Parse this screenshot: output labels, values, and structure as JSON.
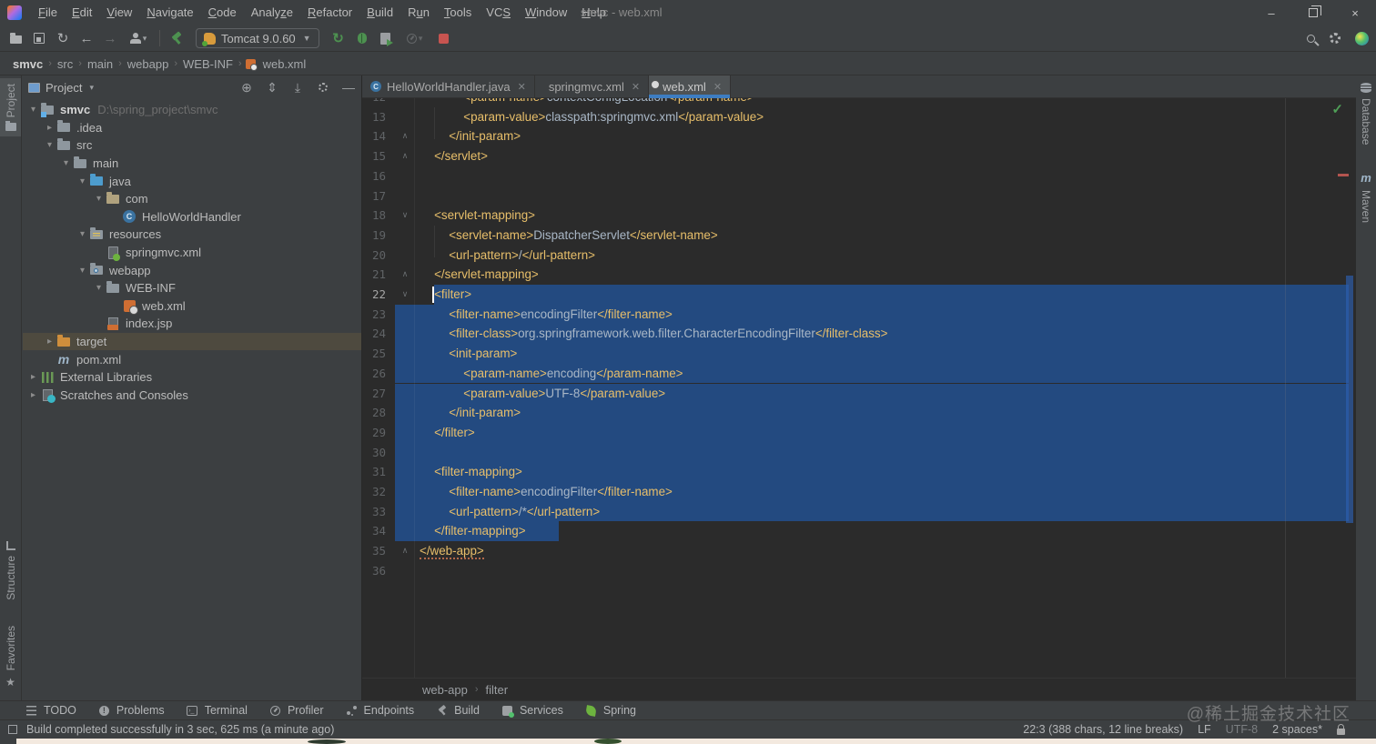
{
  "window": {
    "title": "smvc - web.xml",
    "menus": [
      {
        "label": "File",
        "u": 0
      },
      {
        "label": "Edit",
        "u": 0
      },
      {
        "label": "View",
        "u": 0
      },
      {
        "label": "Navigate",
        "u": 0
      },
      {
        "label": "Code",
        "u": 0
      },
      {
        "label": "Analyze",
        "u": 5
      },
      {
        "label": "Refactor",
        "u": 0
      },
      {
        "label": "Build",
        "u": 0
      },
      {
        "label": "Run",
        "u": 1
      },
      {
        "label": "Tools",
        "u": 0
      },
      {
        "label": "VCS",
        "u": 2
      },
      {
        "label": "Window",
        "u": 0
      },
      {
        "label": "Help",
        "u": 0
      }
    ]
  },
  "toolbar": {
    "run_config": "Tomcat 9.0.60"
  },
  "breadcrumbs": [
    "smvc",
    "src",
    "main",
    "webapp",
    "WEB-INF",
    "web.xml"
  ],
  "left_stripe": {
    "project": "Project",
    "structure": "Structure",
    "favorites": "Favorites"
  },
  "right_stripe": {
    "database": "Database",
    "maven": "Maven"
  },
  "project_panel": {
    "title": "Project",
    "tree": [
      {
        "depth": 0,
        "chevron": "open",
        "icon": "module",
        "label": "smvc",
        "hint": "D:\\spring_project\\smvc",
        "bold": true
      },
      {
        "depth": 1,
        "chevron": "closed",
        "icon": "folder",
        "label": ".idea"
      },
      {
        "depth": 1,
        "chevron": "open",
        "icon": "folder",
        "label": "src"
      },
      {
        "depth": 2,
        "chevron": "open",
        "icon": "folder",
        "label": "main"
      },
      {
        "depth": 3,
        "chevron": "open",
        "icon": "folder-src",
        "label": "java"
      },
      {
        "depth": 4,
        "chevron": "open",
        "icon": "package",
        "label": "com"
      },
      {
        "depth": 5,
        "chevron": "none",
        "icon": "class",
        "label": "HelloWorldHandler"
      },
      {
        "depth": 3,
        "chevron": "open",
        "icon": "folder-res",
        "label": "resources"
      },
      {
        "depth": 4,
        "chevron": "none",
        "icon": "file-spring",
        "label": "springmvc.xml"
      },
      {
        "depth": 3,
        "chevron": "open",
        "icon": "folder-web",
        "label": "webapp"
      },
      {
        "depth": 4,
        "chevron": "open",
        "icon": "folder",
        "label": "WEB-INF"
      },
      {
        "depth": 5,
        "chevron": "none",
        "icon": "file-web",
        "label": "web.xml"
      },
      {
        "depth": 4,
        "chevron": "none",
        "icon": "file-jsp",
        "label": "index.jsp"
      },
      {
        "depth": 1,
        "chevron": "closed",
        "icon": "folder-exc",
        "label": "target",
        "selected": true
      },
      {
        "depth": 1,
        "chevron": "none",
        "icon": "file-maven",
        "label": "pom.xml"
      },
      {
        "depth": 0,
        "chevron": "closed",
        "icon": "libs",
        "label": "External Libraries"
      },
      {
        "depth": 0,
        "chevron": "closed",
        "icon": "scratch",
        "label": "Scratches and Consoles"
      }
    ]
  },
  "tabs": [
    {
      "icon": "class",
      "label": "HelloWorldHandler.java",
      "active": false
    },
    {
      "icon": "spring",
      "label": "springmvc.xml",
      "active": false
    },
    {
      "icon": "web",
      "label": "web.xml",
      "active": true
    }
  ],
  "editor": {
    "breadcrumb": [
      "web-app",
      "filter"
    ],
    "lines": [
      {
        "n": 12,
        "col": 7,
        "segs": [
          [
            "tag",
            "<param-name>"
          ],
          [
            "txt",
            "contextConfigLocation"
          ],
          [
            "tag",
            "</param-name>"
          ]
        ]
      },
      {
        "n": 13,
        "col": 7,
        "segs": [
          [
            "tag",
            "<param-value>"
          ],
          [
            "txt",
            "classpath:springmvc.xml"
          ],
          [
            "tag",
            "</param-value>"
          ]
        ]
      },
      {
        "n": 14,
        "col": 5,
        "segs": [
          [
            "tag",
            "</init-param>"
          ]
        ],
        "fold": "end"
      },
      {
        "n": 15,
        "col": 3,
        "segs": [
          [
            "tag",
            "</servlet>"
          ]
        ],
        "fold": "end"
      },
      {
        "n": 16,
        "col": 1,
        "segs": []
      },
      {
        "n": 17,
        "col": 1,
        "segs": []
      },
      {
        "n": 18,
        "col": 3,
        "segs": [
          [
            "tag",
            "<servlet-mapping>"
          ]
        ],
        "fold": "start"
      },
      {
        "n": 19,
        "col": 5,
        "segs": [
          [
            "tag",
            "<servlet-name>"
          ],
          [
            "txt",
            "DispatcherServlet"
          ],
          [
            "tag",
            "</servlet-name>"
          ]
        ]
      },
      {
        "n": 20,
        "col": 5,
        "segs": [
          [
            "tag",
            "<url-pattern>"
          ],
          [
            "txt",
            "/"
          ],
          [
            "tag",
            "</url-pattern>"
          ]
        ]
      },
      {
        "n": 21,
        "col": 3,
        "segs": [
          [
            "tag",
            "</servlet-mapping>"
          ]
        ],
        "fold": "end"
      },
      {
        "n": 22,
        "col": 3,
        "segs": [
          [
            "tag",
            "<filter>"
          ]
        ],
        "fold": "start",
        "sel": "caret",
        "caret": true,
        "active": true
      },
      {
        "n": 23,
        "col": 5,
        "segs": [
          [
            "tag",
            "<filter-name>"
          ],
          [
            "txt",
            "encodingFilter"
          ],
          [
            "tag",
            "</filter-name>"
          ]
        ],
        "sel": "full"
      },
      {
        "n": 24,
        "col": 5,
        "segs": [
          [
            "tag",
            "<filter-class>"
          ],
          [
            "txt",
            "org.springframework.web.filter.CharacterEncodingFilter"
          ],
          [
            "tag",
            "</filter-class>"
          ]
        ],
        "sel": "full"
      },
      {
        "n": 25,
        "col": 5,
        "segs": [
          [
            "tag",
            "<init-param>"
          ]
        ],
        "fold": "start",
        "sel": "full"
      },
      {
        "n": 26,
        "col": 7,
        "segs": [
          [
            "tag",
            "<param-name>"
          ],
          [
            "txt",
            "encoding"
          ],
          [
            "tag",
            "</param-name>"
          ]
        ],
        "sel": "full"
      },
      {
        "n": 27,
        "col": 7,
        "segs": [
          [
            "tag",
            "<param-value>"
          ],
          [
            "txt",
            "UTF-8"
          ],
          [
            "tag",
            "</param-value>"
          ]
        ],
        "sel": "full"
      },
      {
        "n": 28,
        "col": 5,
        "segs": [
          [
            "tag",
            "</init-param>"
          ]
        ],
        "fold": "end",
        "sel": "full"
      },
      {
        "n": 29,
        "col": 3,
        "segs": [
          [
            "tag",
            "</filter>"
          ]
        ],
        "fold": "end",
        "sel": "full"
      },
      {
        "n": 30,
        "col": 1,
        "segs": [],
        "sel": "full"
      },
      {
        "n": 31,
        "col": 3,
        "segs": [
          [
            "tag",
            "<filter-mapping>"
          ]
        ],
        "fold": "start",
        "sel": "full"
      },
      {
        "n": 32,
        "col": 5,
        "segs": [
          [
            "tag",
            "<filter-name>"
          ],
          [
            "txt",
            "encodingFilter"
          ],
          [
            "tag",
            "</filter-name>"
          ]
        ],
        "sel": "full"
      },
      {
        "n": 33,
        "col": 5,
        "segs": [
          [
            "tag",
            "<url-pattern>"
          ],
          [
            "txt",
            "/*"
          ],
          [
            "tag",
            "</url-pattern>"
          ]
        ],
        "sel": "full"
      },
      {
        "n": 34,
        "col": 3,
        "segs": [
          [
            "tag",
            "</filter-mapping>"
          ]
        ],
        "fold": "end",
        "sel": "text"
      },
      {
        "n": 35,
        "col": 1,
        "segs": [
          [
            "tag",
            "</web-app>"
          ]
        ],
        "fold": "end",
        "wavy": true
      },
      {
        "n": 36,
        "col": 1,
        "segs": []
      }
    ]
  },
  "bottom_bar": [
    {
      "icon": "todo",
      "label": "TODO"
    },
    {
      "icon": "problems",
      "label": "Problems"
    },
    {
      "icon": "terminal",
      "label": "Terminal"
    },
    {
      "icon": "profiler",
      "label": "Profiler"
    },
    {
      "icon": "endpoints",
      "label": "Endpoints"
    },
    {
      "icon": "build",
      "label": "Build"
    },
    {
      "icon": "services",
      "label": "Services"
    },
    {
      "icon": "spring",
      "label": "Spring"
    }
  ],
  "status_bar": {
    "message": "Build completed successfully in 3 sec, 625 ms (a minute ago)",
    "caret_info": "22:3 (388 chars, 12 line breaks)",
    "line_ending": "LF",
    "encoding": "UTF-8",
    "indent": "2 spaces*"
  },
  "watermark": "@稀土掘金技术社区",
  "colors": {
    "selection": "#234a80",
    "tag": "#e8bf6a",
    "text": "#a9b7c6",
    "accent": "#3d7dc2",
    "green": "#4d9150",
    "red": "#c75450",
    "editor_bg": "#2b2b2b",
    "panel_bg": "#3c3f41"
  }
}
